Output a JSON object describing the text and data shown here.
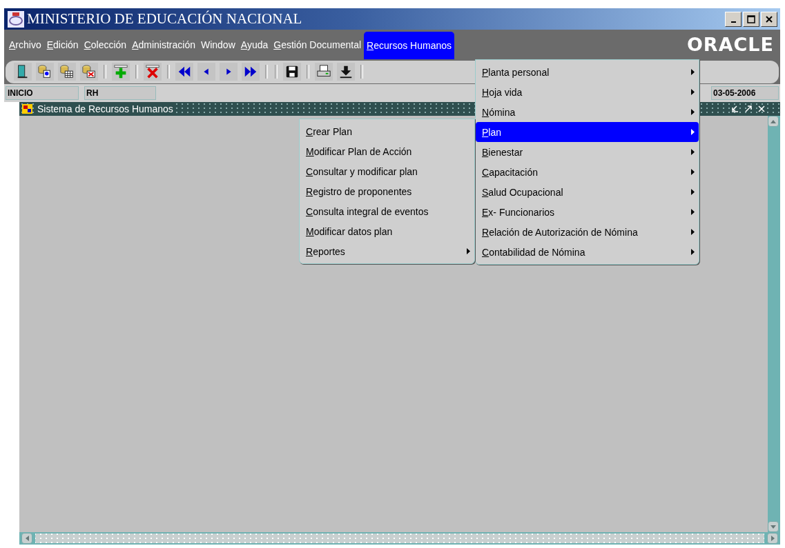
{
  "window": {
    "title": "MINISTERIO DE EDUCACIÓN NACIONAL"
  },
  "menubar": [
    {
      "label": "Archivo",
      "mnemonic": true,
      "selected": false
    },
    {
      "label": "Edición",
      "mnemonic": true,
      "selected": false
    },
    {
      "label": "Colección",
      "mnemonic": true,
      "selected": false
    },
    {
      "label": "Administración",
      "mnemonic": true,
      "selected": false
    },
    {
      "label": "Window",
      "mnemonic": false,
      "selected": false
    },
    {
      "label": "Ayuda",
      "mnemonic": true,
      "selected": false
    },
    {
      "label": "Gestión Documental",
      "mnemonic": true,
      "selected": false
    },
    {
      "label": "Recursos Humanos",
      "mnemonic": true,
      "selected": true
    }
  ],
  "brand": "ORACLE",
  "status_fields": [
    "INICIO",
    "RH"
  ],
  "date": "03-05-2006",
  "inner_window": {
    "title": "Sistema de Recursos Humanos"
  },
  "menu": [
    {
      "label": "Planta personal",
      "selected": false
    },
    {
      "label": "Hoja vida",
      "selected": false
    },
    {
      "label": "Nómina",
      "selected": false
    },
    {
      "label": "Plan",
      "selected": true
    },
    {
      "label": "Bienestar",
      "selected": false
    },
    {
      "label": "Capacitación",
      "selected": false
    },
    {
      "label": "Salud Ocupacional",
      "selected": false
    },
    {
      "label": "Ex- Funcionarios",
      "selected": false
    },
    {
      "label": "Relación de Autorización de Nómina",
      "selected": false
    },
    {
      "label": "Contabilidad de Nómina",
      "selected": false
    }
  ],
  "submenu": [
    {
      "label": "Crear Plan",
      "has_submenu": false
    },
    {
      "label": "Modificar Plan de Acción",
      "has_submenu": false
    },
    {
      "label": "Consultar y modificar plan",
      "has_submenu": false
    },
    {
      "label": "Registro de proponentes",
      "has_submenu": false
    },
    {
      "label": "Consulta integral de eventos",
      "has_submenu": false
    },
    {
      "label": "Modificar datos plan",
      "has_submenu": false
    },
    {
      "label": "Reportes",
      "has_submenu": true
    }
  ]
}
